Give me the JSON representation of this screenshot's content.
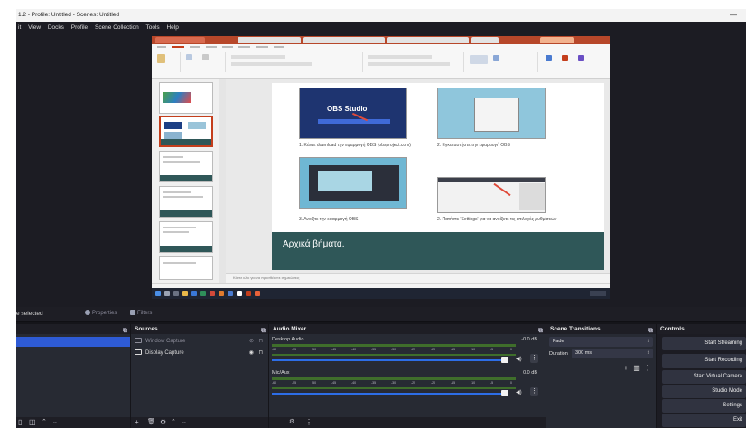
{
  "window": {
    "title": "1.2 - Profile: Untitled - Scenes: Untitled",
    "minimize_glyph": "—"
  },
  "menu": [
    "it",
    "View",
    "Docks",
    "Profile",
    "Scene Collection",
    "Tools",
    "Help"
  ],
  "capture": {
    "slide_captions": [
      "1. Κάντε download την εφαρμογή OBS (obsproject.com)",
      "2. Εγκαταστήστε την εφαρμογή OBS",
      "3. Ανοίξτε την εφαρμογή OBS",
      "2. Πατήστε 'Settings' για να ανοίξετε τις επιλογές ρυθμίσεων"
    ],
    "slide_title": "Αρχικά βήματα.",
    "obs_studio_text": "OBS Studio",
    "notes_placeholder": "Κάντε κλικ για να προσθέσετε σημειώσεις"
  },
  "source_bar": {
    "no_source": "e selected",
    "properties": "Properties",
    "filters": "Filters"
  },
  "docks": {
    "scenes": {
      "title": "",
      "float_icon": "⧉"
    },
    "sources": {
      "title": "Sources",
      "items": [
        {
          "name": "Window Capture",
          "visible": false
        },
        {
          "name": "Display Capture",
          "visible": true
        }
      ]
    },
    "mixer": {
      "title": "Audio Mixer",
      "channels": [
        {
          "name": "Desktop Audio",
          "db": "-0.0 dB"
        },
        {
          "name": "Mic/Aux",
          "db": "0.0 dB"
        }
      ],
      "ticks": [
        "-60",
        "-55",
        "-50",
        "-45",
        "-40",
        "-35",
        "-30",
        "-25",
        "-20",
        "-15",
        "-10",
        "-5",
        "0"
      ]
    },
    "transitions": {
      "title": "Scene Transitions",
      "selected": "Fade",
      "duration_label": "Duration",
      "duration_value": "300 ms"
    },
    "controls": {
      "title": "Controls",
      "buttons": [
        "Start Streaming",
        "Start Recording",
        "Start Virtual Camera",
        "Studio Mode",
        "Settings",
        "Exit"
      ]
    }
  },
  "colors": {
    "accent": "#2e5bd5",
    "panel": "#272a33",
    "ppt_brand": "#b7472a",
    "slide_band": "#2f5758"
  }
}
